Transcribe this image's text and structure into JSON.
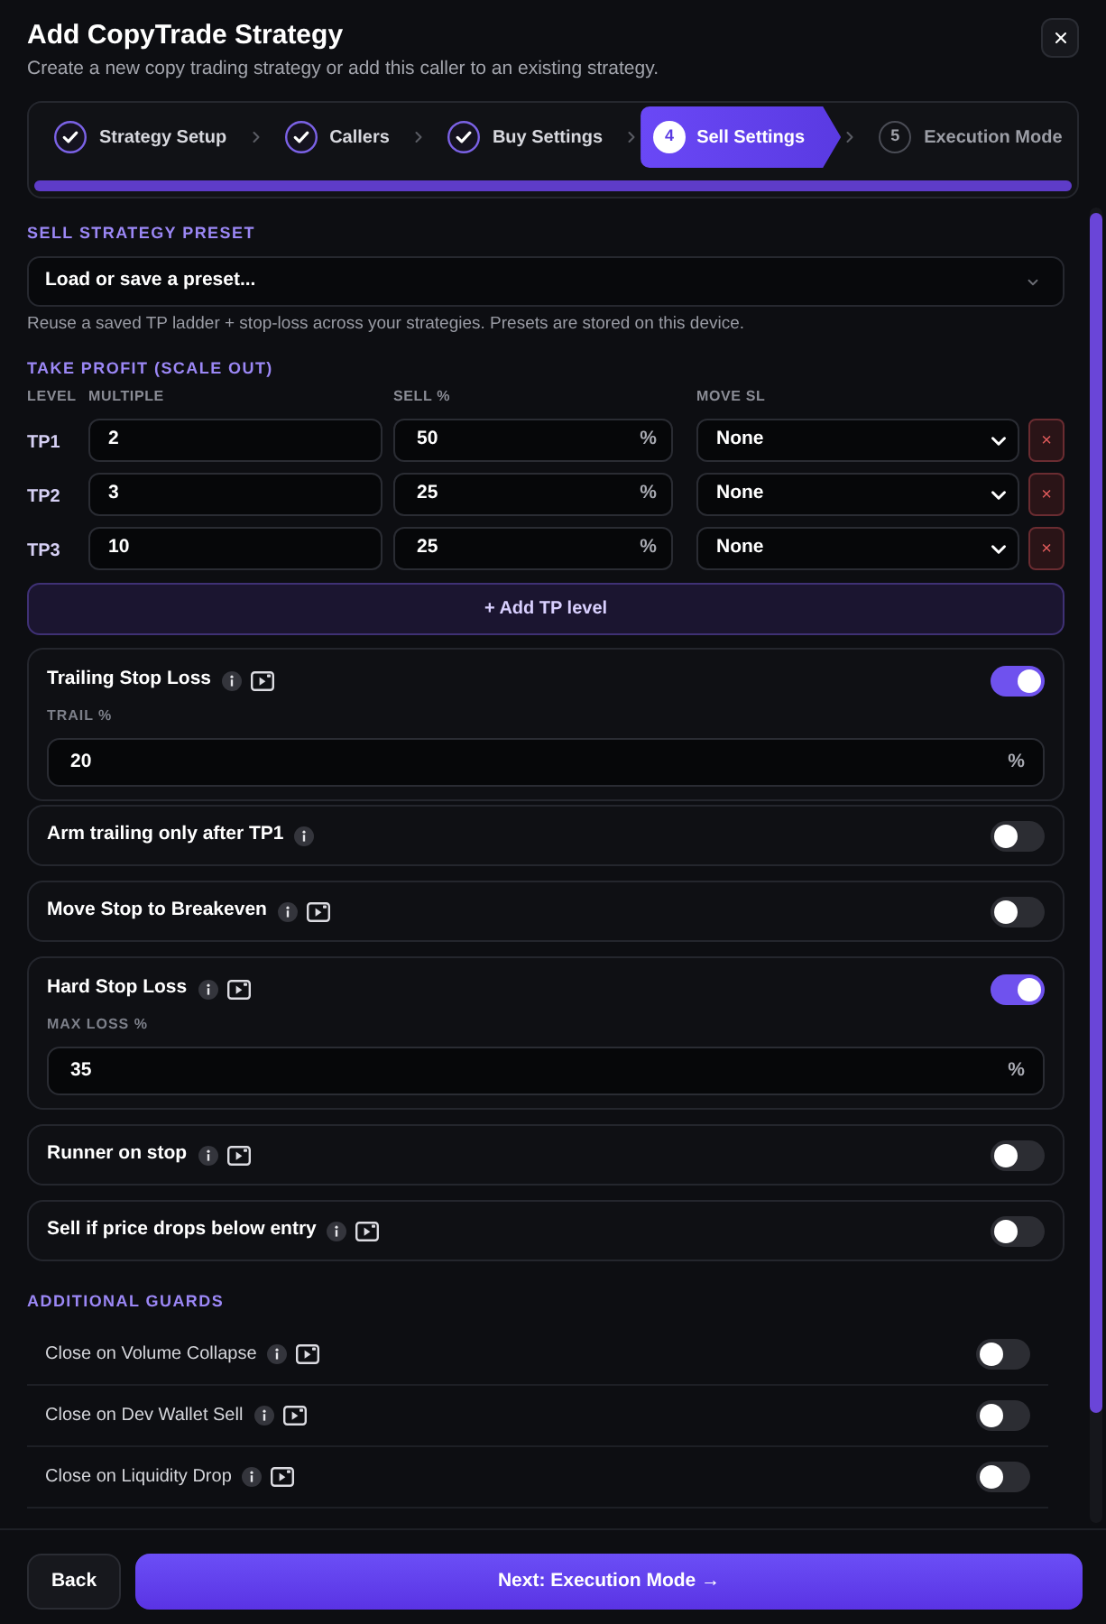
{
  "dialog": {
    "title": "Add CopyTrade Strategy",
    "subtitle": "Create a new copy trading strategy or add this caller to an existing strategy."
  },
  "stepper": {
    "steps": [
      {
        "label": "Strategy Setup",
        "completed": true,
        "selected": false
      },
      {
        "label": "Callers",
        "completed": true,
        "selected": false
      },
      {
        "label": "Buy Settings",
        "completed": true,
        "selected": false
      },
      {
        "number": "4",
        "label": "Sell Settings",
        "completed": false,
        "selected": true
      },
      {
        "number": "5",
        "label": "Execution Mode",
        "completed": false,
        "selected": false
      }
    ],
    "progress": {
      "level": 1
    }
  },
  "preset": {
    "title": "SELL STRATEGY PRESET",
    "select": {
      "value": "Load or save a preset..."
    },
    "help": "Reuse a saved TP ladder + stop-loss across your strategies. Presets are stored on this device."
  },
  "take_profit": {
    "title": "TAKE PROFIT (SCALE OUT)",
    "columns": [
      "LEVEL",
      "MULTIPLE",
      "SELL %",
      "MOVE SL"
    ],
    "rows": [
      {
        "name": "TP1",
        "multiple": "2",
        "sell": "50",
        "unit": "%",
        "move_sl": "None",
        "remove": "×"
      },
      {
        "name": "TP2",
        "multiple": "3",
        "sell": "25",
        "unit": "%",
        "move_sl": "None",
        "remove": "×"
      },
      {
        "name": "TP3",
        "multiple": "10",
        "sell": "25",
        "unit": "%",
        "move_sl": "None",
        "remove": "×"
      }
    ],
    "add_button": "+ Add TP level"
  },
  "stop_cards": [
    {
      "title": "Trailing Stop Loss",
      "info": true,
      "video": true,
      "on": true,
      "field": {
        "label": "TRAIL %",
        "value": "20",
        "unit": "%"
      },
      "sub_option": {
        "title": "Arm trailing only after TP1",
        "info": true,
        "video": false,
        "on": false
      }
    },
    {
      "title": "Move Stop to Breakeven",
      "info": true,
      "video": true,
      "on": false
    },
    {
      "title": "Hard Stop Loss",
      "info": true,
      "video": true,
      "on": true,
      "field": {
        "label": "MAX LOSS %",
        "value": "35",
        "unit": "%"
      }
    },
    {
      "title": "Runner on stop",
      "info": true,
      "video": true,
      "on": false
    },
    {
      "title": "Sell if price drops below entry",
      "info": true,
      "video": true,
      "on": false
    }
  ],
  "additional_guards": {
    "title": "ADDITIONAL GUARDS",
    "items": [
      {
        "label": "Close on Volume Collapse",
        "info": true,
        "video": true,
        "on": false
      },
      {
        "label": "Close on Dev Wallet Sell",
        "info": true,
        "video": true,
        "on": false
      },
      {
        "label": "Close on Liquidity Drop",
        "info": true,
        "video": true,
        "on": false
      }
    ]
  },
  "footer": {
    "back": "Back",
    "next": "Next: Execution Mode →"
  }
}
